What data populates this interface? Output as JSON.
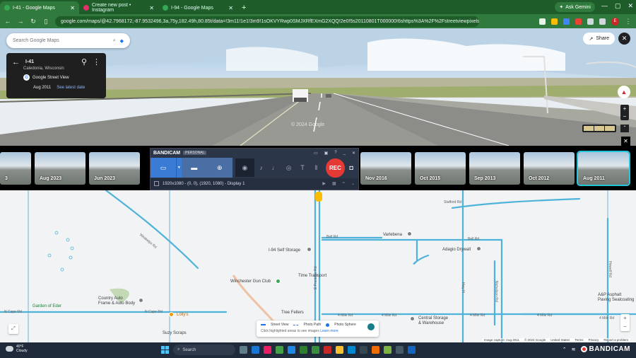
{
  "browser": {
    "tabs": [
      {
        "title": "I-41 - Google Maps",
        "active": true
      },
      {
        "title": "Create new post • Instagram",
        "active": false
      },
      {
        "title": "I-94 - Google Maps",
        "active": false
      }
    ],
    "new_tab": "+",
    "gemini": "Ask Gemini",
    "url": "google.com/maps/@42.7968172,-87.9532496,3a,75y,182.49h,80.85t/data=!3m11!1e1!3m9!1sOKVYRwp0SMJXRfEXmG2XQQ!2e0!5s20110801T000000!6shttps%3A%2F%2Fstreetviewpixels-pa.googleapis.com%2...",
    "profile_initial": "E"
  },
  "streetview": {
    "search_placeholder": "Search Google Maps",
    "title": "I-41",
    "subtitle": "Caledonia, Wisconsin",
    "provider": "Google Street View",
    "capture_date": "Aug 2011",
    "latest_link": "See latest date",
    "share": "Share",
    "watermark": "© 2024 Google"
  },
  "timeline": {
    "thumbs": [
      {
        "label": "3"
      },
      {
        "label": "Aug 2023"
      },
      {
        "label": "Jun 2023"
      },
      {
        "label": "Nov 2016"
      },
      {
        "label": "Oct 2015"
      },
      {
        "label": "Sep 2013"
      },
      {
        "label": "Oct 2012"
      },
      {
        "label": "Aug 2011"
      }
    ]
  },
  "bandicam": {
    "logo": "BANDICAM",
    "badge": "PERSONAL",
    "rec": "REC",
    "status": "1920x1080 - (0, 0), (1920, 1080) - Display 1"
  },
  "map": {
    "places": {
      "varlebena": "Varlebena",
      "selfstorage": "I-94 Self Storage",
      "adagio": "Adagio Drywall",
      "transport": "Time Transport",
      "gunclub": "Winchester Gun Club",
      "country": "Country Auto\nFrame & Auto Body",
      "eden": "Garden of Eder",
      "lollys": "Lolly's",
      "treefellers": "Tree Fellers",
      "central": "Central Storage\n& Warehouse",
      "suzy": "Suzy Scraps",
      "asp": "A&P Asphalt\nPaving Sealcoating"
    },
    "roads": {
      "ncape1": "N Cape Rd",
      "ncape2": "N Cape Rd",
      "mile1": "4 Mile Rd",
      "mile2": "4 Mile Rd",
      "mile3": "4 Mile Rd",
      "mile4": "4 Mile Rd",
      "mile5": "4 Mile Rd",
      "bell1": "Bell Rd",
      "bell2": "Bell Rd",
      "frontage": "E Frontage Rd",
      "howell": "Howell Rd",
      "hwy": "Hwy H",
      "stafford": "Stafford Rd",
      "nicholson": "Nicholson Rd",
      "weakelps": "Weakelps Rd"
    },
    "legend": {
      "street_view": "Street View",
      "photo_path": "Photo Path",
      "photo_sphere": "Photo Sphere",
      "hint": "Click highlighted areas to see images",
      "learn_more": "Learn more"
    },
    "attribution": [
      "Image capture: Aug 2011",
      "© 2024 Google",
      "United States",
      "Terms",
      "Privacy",
      "Report a problem"
    ]
  },
  "taskbar": {
    "temp": "40°F",
    "condition": "Cloudy",
    "search": "Search",
    "watermark": "BANDICAM"
  }
}
